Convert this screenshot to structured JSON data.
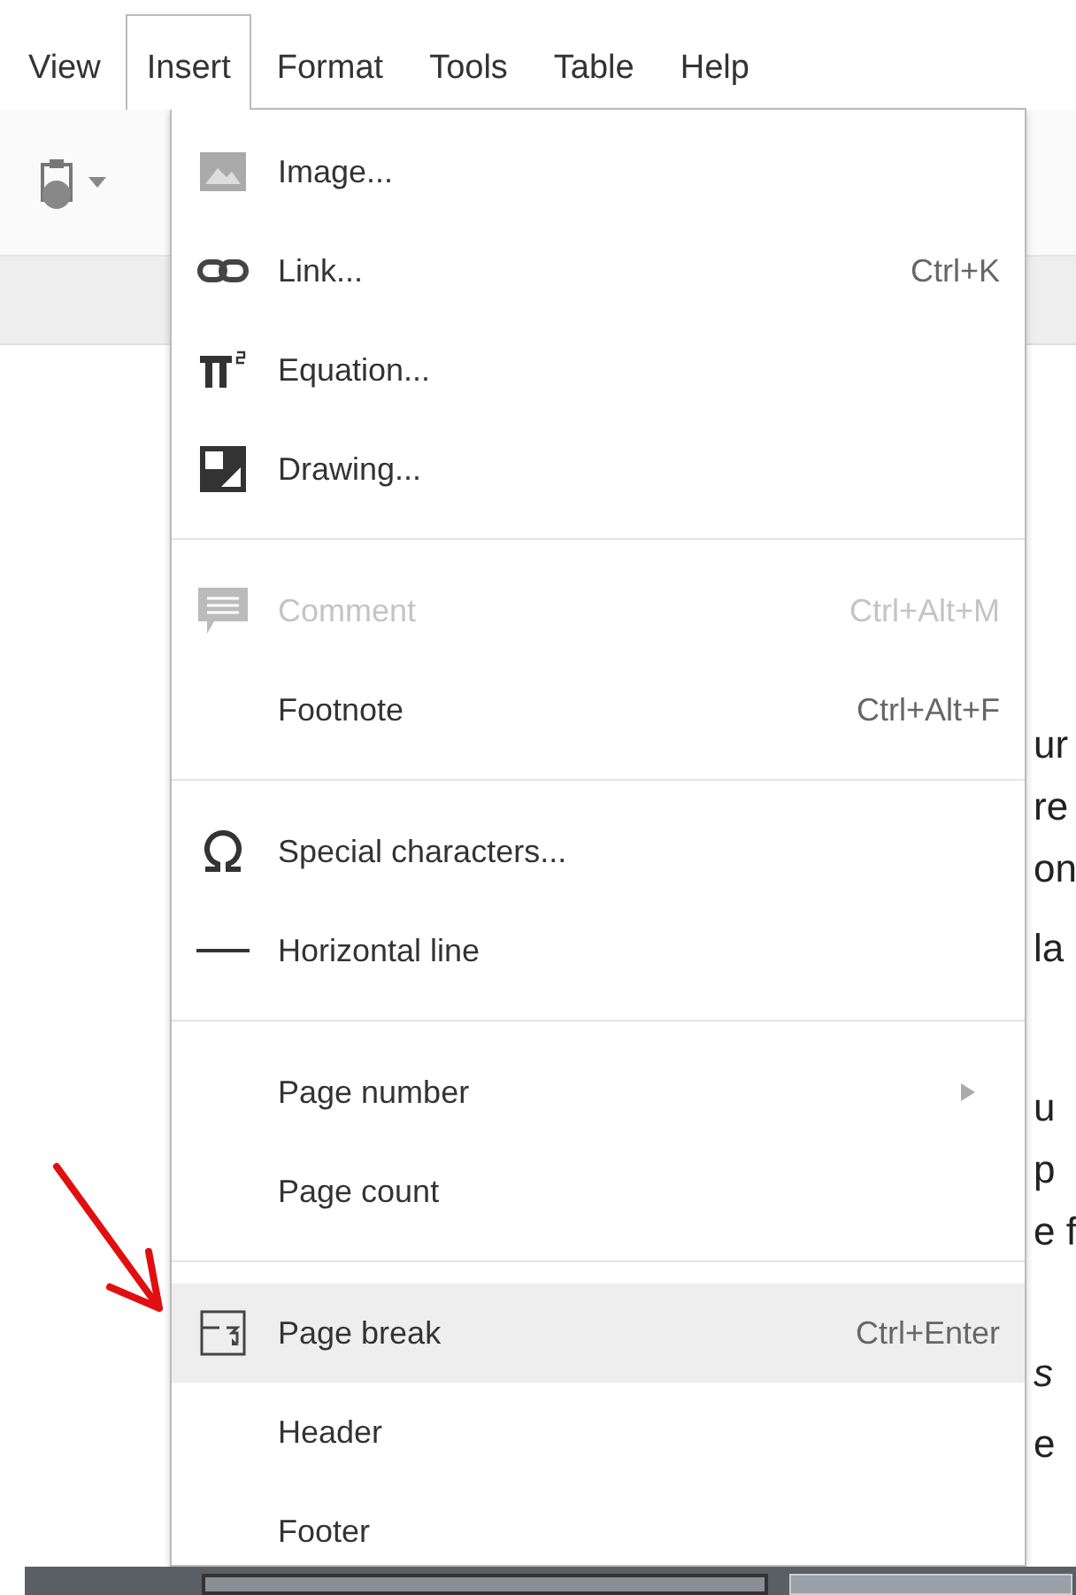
{
  "menubar": [
    {
      "label": "View",
      "selected": false
    },
    {
      "label": "Insert",
      "selected": true
    },
    {
      "label": "Format",
      "selected": false
    },
    {
      "label": "Tools",
      "selected": false
    },
    {
      "label": "Table",
      "selected": false
    },
    {
      "label": "Help",
      "selected": false
    }
  ],
  "menu": [
    {
      "kind": "item",
      "label": "Image...",
      "disabled": false,
      "selected": false
    },
    {
      "kind": "item",
      "label": "Link...",
      "shortcut": "Ctrl+K",
      "disabled": false,
      "selected": false
    },
    {
      "kind": "item",
      "label": "Equation...",
      "disabled": false,
      "selected": false
    },
    {
      "kind": "item",
      "label": "Drawing...",
      "disabled": false,
      "selected": false
    },
    {
      "kind": "separator"
    },
    {
      "kind": "item",
      "label": "Comment",
      "shortcut": "Ctrl+Alt+M",
      "disabled": true,
      "selected": false
    },
    {
      "kind": "item",
      "label": "Footnote",
      "shortcut": "Ctrl+Alt+F",
      "disabled": false,
      "selected": false
    },
    {
      "kind": "separator"
    },
    {
      "kind": "item",
      "label": "Special characters...",
      "disabled": false,
      "selected": false
    },
    {
      "kind": "item",
      "label": "Horizontal line",
      "disabled": false,
      "selected": false
    },
    {
      "kind": "separator"
    },
    {
      "kind": "submenu",
      "label": "Page number",
      "disabled": false,
      "selected": false
    },
    {
      "kind": "item",
      "label": "Page count",
      "disabled": false,
      "selected": false
    },
    {
      "kind": "separator"
    },
    {
      "kind": "item",
      "label": "Page break",
      "shortcut": "Ctrl+Enter",
      "disabled": false,
      "selected": true
    },
    {
      "kind": "item",
      "label": "Header",
      "disabled": false,
      "selected": false
    },
    {
      "kind": "item",
      "label": "Footer",
      "disabled": false,
      "selected": false
    }
  ],
  "document_fragments": [
    "ur",
    "re",
    "on",
    "la",
    "u",
    "p",
    "e f",
    "s",
    "e"
  ]
}
